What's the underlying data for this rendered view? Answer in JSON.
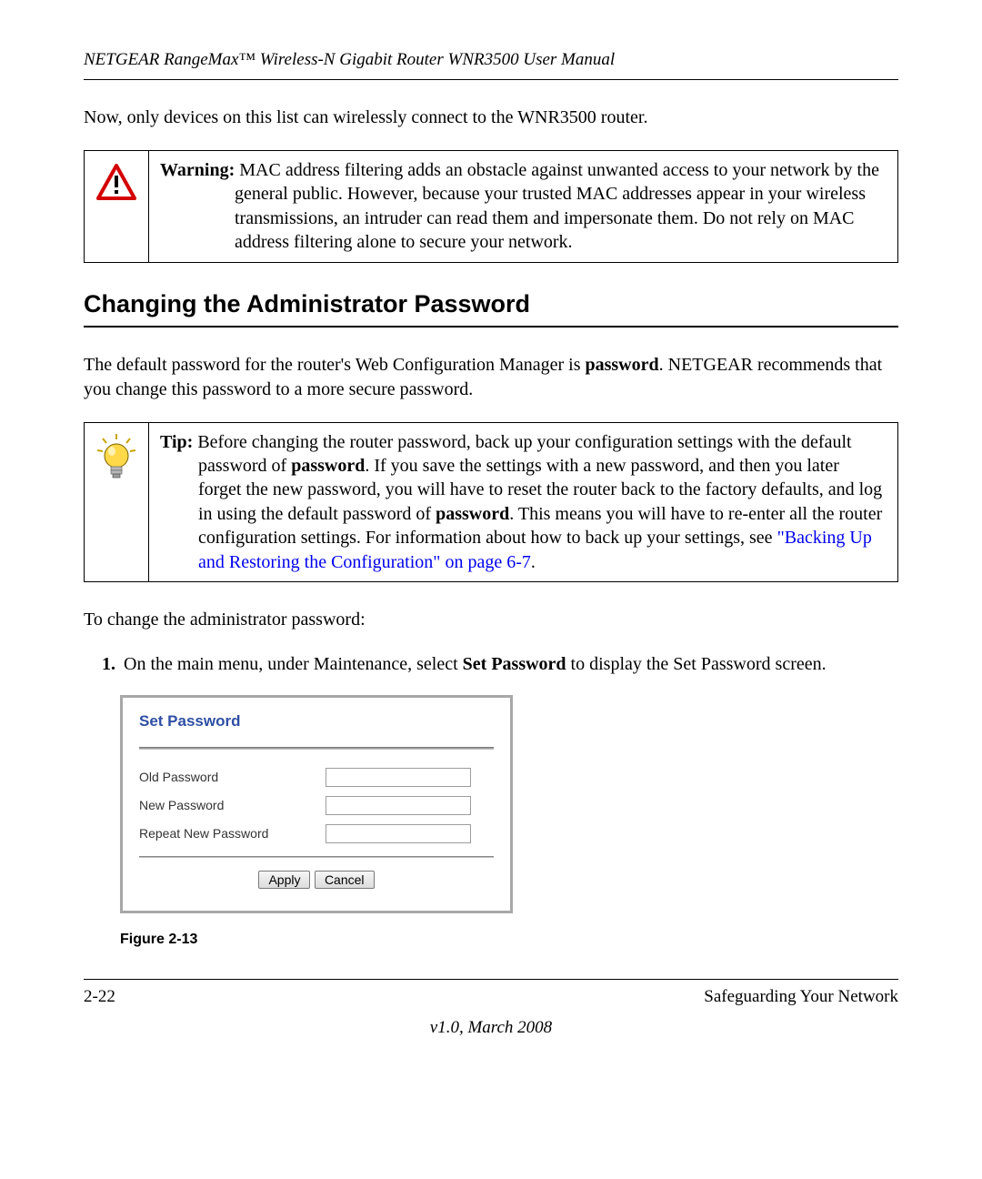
{
  "header": {
    "running_head": "NETGEAR RangeMax™ Wireless-N Gigabit Router WNR3500 User Manual"
  },
  "intro_para": "Now, only devices on this list can wirelessly connect to the WNR3500 router.",
  "warning": {
    "label": "Warning:",
    "text_after_label": " MAC address filtering adds an obstacle against unwanted access to your network by the general public. However, because your trusted MAC addresses appear in your wireless transmissions, an intruder can read them and impersonate them. Do not rely on MAC address filtering alone to secure your network."
  },
  "section_heading": "Changing the Administrator Password",
  "para_after_heading": {
    "pre": "The default password for the router's Web Configuration Manager is ",
    "bold1": "password",
    "post": ". NETGEAR recommends that you change this password to a more secure password."
  },
  "tip": {
    "label": "Tip:",
    "seg1": " Before changing the router password, back up your configuration settings with the default password of ",
    "bold1": "password",
    "seg2": ". If you save the settings with a new password, and then you later forget the new password, you will have to reset the router back to the factory defaults, and log in using the default password of ",
    "bold2": "password",
    "seg3": ". This means you will have to re-enter all the router configuration settings. For information about how to back up your settings, see ",
    "xref": "\"Backing Up and Restoring the Configuration\" on page 6-7",
    "seg4": "."
  },
  "lead_in": "To change the administrator password:",
  "step1": {
    "pre": "On the main menu, under Maintenance, select ",
    "bold": "Set Password",
    "post": " to display the Set Password screen."
  },
  "screenshot": {
    "title": "Set Password",
    "rows": {
      "old": "Old Password",
      "new": "New Password",
      "repeat": "Repeat New Password"
    },
    "buttons": {
      "apply": "Apply",
      "cancel": "Cancel"
    }
  },
  "figure_caption": "Figure 2-13",
  "footer": {
    "page_num": "2-22",
    "section": "Safeguarding Your Network",
    "version": "v1.0, March 2008"
  }
}
